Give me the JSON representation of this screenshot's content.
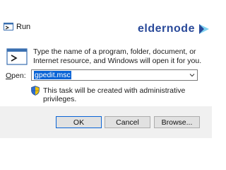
{
  "window": {
    "title": "Run"
  },
  "logo": {
    "text": "eldernode"
  },
  "dialog": {
    "description": "Type the name of a program, folder, document, or Internet resource, and Windows will open it for you.",
    "open_label_prefix": "O",
    "open_label_rest": "pen:",
    "open_value": "gpedit.msc",
    "admin_note": "This task will be created with administrative privileges."
  },
  "buttons": {
    "ok": "OK",
    "cancel": "Cancel",
    "browse": "Browse..."
  },
  "colors": {
    "accent": "#0a64d6",
    "logo": "#2a4a9a",
    "footer": "#f0f0f0"
  }
}
